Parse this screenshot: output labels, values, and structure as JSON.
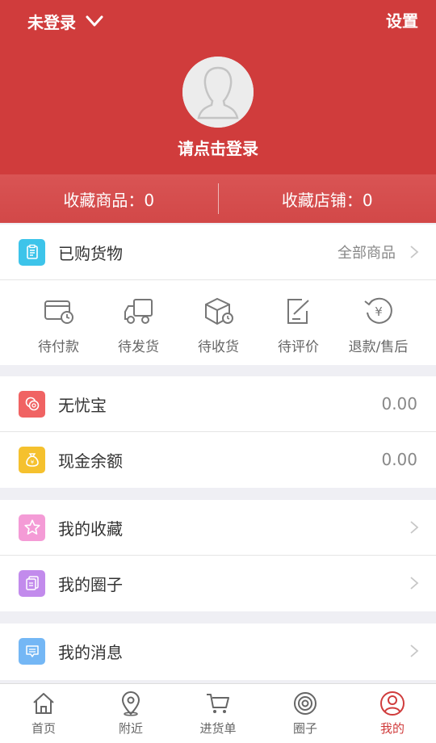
{
  "header": {
    "login_status": "未登录",
    "settings": "设置",
    "login_prompt": "请点击登录"
  },
  "favorites": {
    "goods": "收藏商品：0",
    "shops": "收藏店铺：0"
  },
  "purchased": {
    "label": "已购货物",
    "all_goods": "全部商品"
  },
  "orders": [
    {
      "label": "待付款",
      "icon": "wallet-clock-icon"
    },
    {
      "label": "待发货",
      "icon": "truck-icon"
    },
    {
      "label": "待收货",
      "icon": "box-icon"
    },
    {
      "label": "待评价",
      "icon": "edit-note-icon"
    },
    {
      "label": "退款/售后",
      "icon": "refund-yen-icon"
    }
  ],
  "finance": {
    "wuyoubao_label": "无忧宝",
    "wuyoubao_value": "0.00",
    "cash_label": "现金余额",
    "cash_value": "0.00"
  },
  "menu": {
    "collection": "我的收藏",
    "circle": "我的圈子",
    "messages": "我的消息"
  },
  "tabbar": [
    {
      "label": "首页",
      "icon": "home-icon"
    },
    {
      "label": "附近",
      "icon": "location-pin-icon"
    },
    {
      "label": "进货单",
      "icon": "cart-icon"
    },
    {
      "label": "圈子",
      "icon": "target-icon"
    },
    {
      "label": "我的",
      "icon": "user-icon",
      "active": true
    }
  ],
  "colors": {
    "brand_red": "#d03c3c",
    "wuyoubao_icon": "#f06363",
    "cash_icon": "#f5c12e",
    "collection_icon": "#f49bd6",
    "circle_icon": "#c28bec",
    "messages_icon": "#74b7f5",
    "purchased_icon": "#3dc4ea"
  }
}
